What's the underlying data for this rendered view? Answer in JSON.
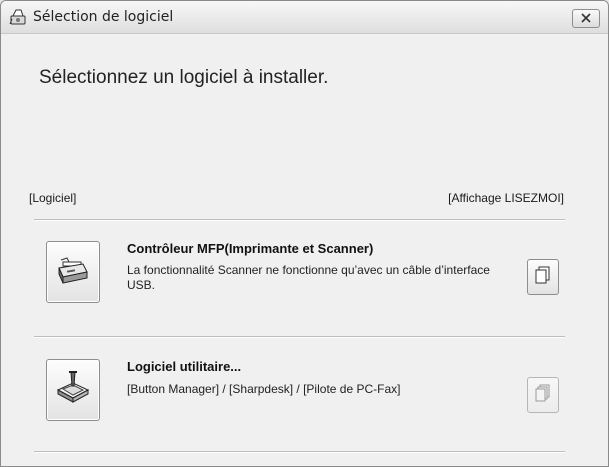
{
  "window": {
    "title": "Sélection de logiciel",
    "icon": "installer-icon",
    "close_icon": "close-icon"
  },
  "main": {
    "heading": "Sélectionnez un logiciel à installer.",
    "section_label": "[Logiciel]",
    "readme_label": "[Affichage LISEZMOI]"
  },
  "items": [
    {
      "title": "Contrôleur MFP(Imprimante et Scanner)",
      "description": "La fonctionnalité Scanner ne fonctionne qu’avec un câble d’interface USB.",
      "icon": "printer-scanner-icon",
      "readme_icon": "document-icon",
      "readme_enabled": true
    },
    {
      "title": "Logiciel utilitaire...",
      "description": "[Button Manager] / [Sharpdesk] / [Pilote de PC-Fax]",
      "icon": "utility-software-icon",
      "readme_icon": "documents-icon",
      "readme_enabled": false
    }
  ]
}
